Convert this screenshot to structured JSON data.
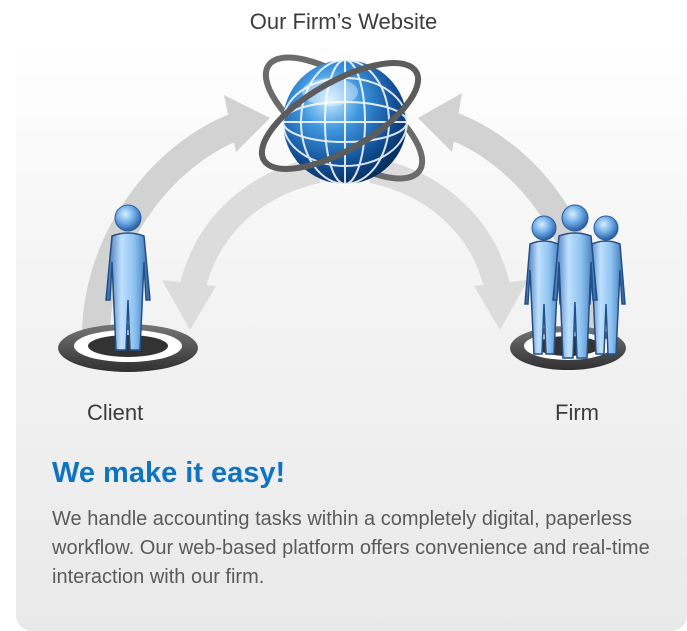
{
  "diagram": {
    "top_label": "Our Firm’s Website",
    "left_label": "Client",
    "right_label": "Firm"
  },
  "content": {
    "headline": "We make it easy!",
    "description": "We handle accounting tasks within a completely digital, paperless workflow. Our web-based platform offers convenience and real-time interaction with our firm."
  },
  "colors": {
    "headline": "#0f74c0",
    "figure_blue": "#4f8fd2",
    "arrow_gray": "#cdcdcd",
    "globe_blue": "#1f6ab6"
  },
  "icons": [
    "globe-icon",
    "client-person-icon",
    "firm-group-icon",
    "platform-ring-icon",
    "arrow-icon"
  ]
}
